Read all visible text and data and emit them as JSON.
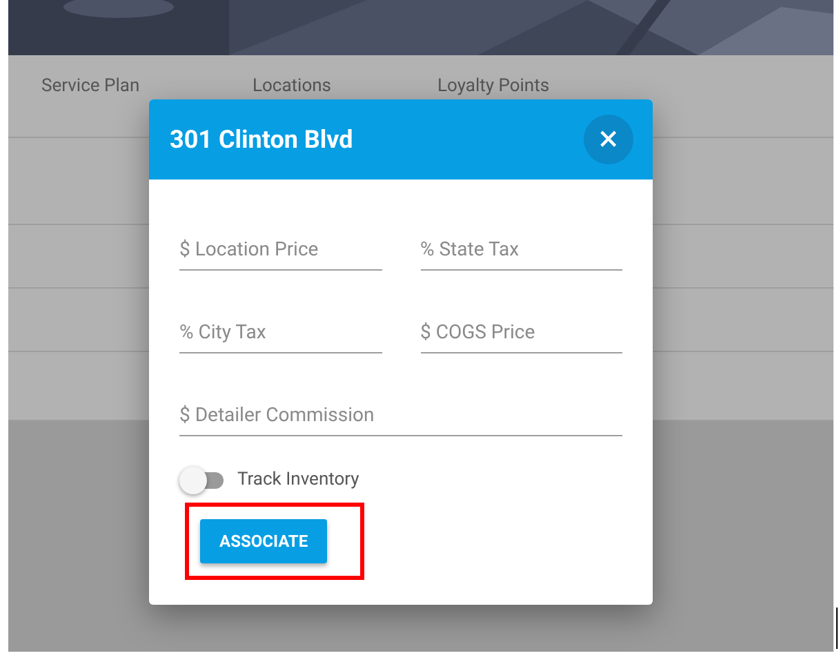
{
  "table": {
    "columns": [
      "Service Plan",
      "Locations",
      "Loyalty Points"
    ]
  },
  "dialog": {
    "title": "301 Clinton Blvd",
    "close": "×",
    "fields": [
      {
        "placeholder": "$ Location Price",
        "wide": false
      },
      {
        "placeholder": "% State Tax",
        "wide": false
      },
      {
        "placeholder": "% City Tax",
        "wide": false
      },
      {
        "placeholder": "$ COGS Price",
        "wide": false
      },
      {
        "placeholder": "$ Detailer Commission",
        "wide": true
      }
    ],
    "toggle": {
      "label": "Track Inventory",
      "on": false
    },
    "button": "ASSOCIATE"
  }
}
